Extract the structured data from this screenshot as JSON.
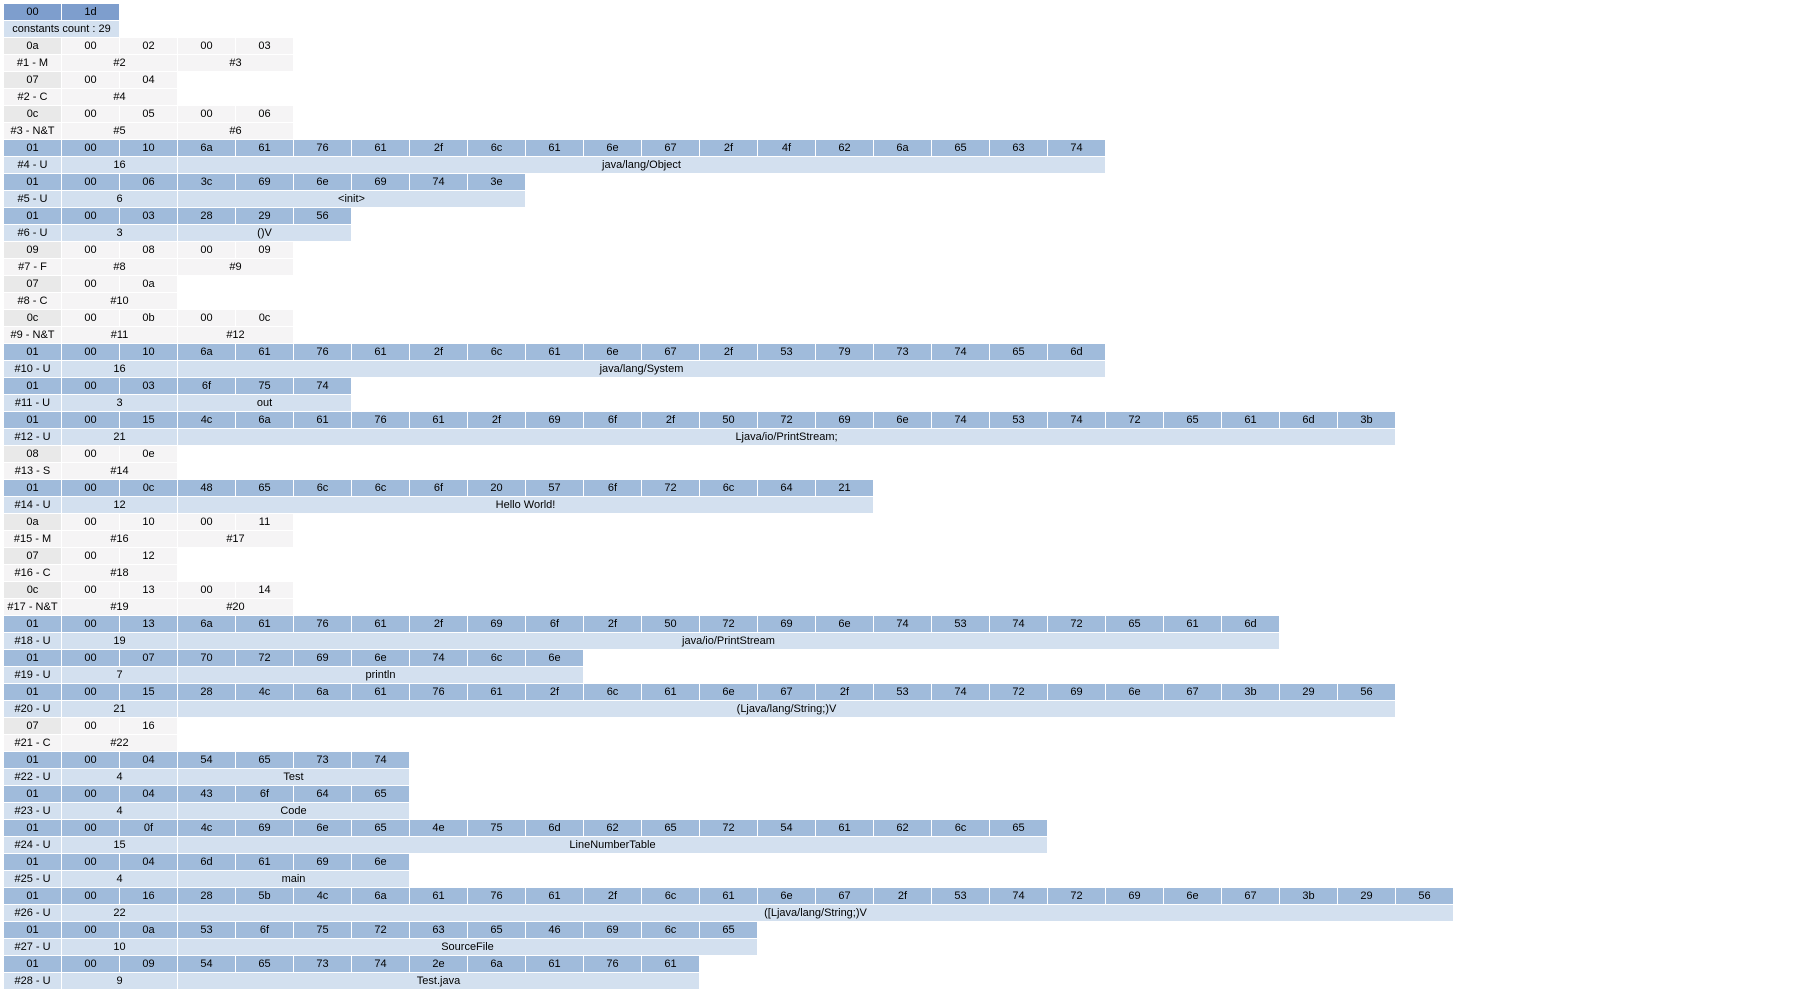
{
  "header_count_hex": [
    "00",
    "1d"
  ],
  "header_count_label": "constants count : 29",
  "constants": [
    {
      "id": 1,
      "type": "M",
      "hex": [
        "0a",
        "00",
        "02",
        "00",
        "03"
      ],
      "refs": [
        "#2",
        "#3"
      ]
    },
    {
      "id": 2,
      "type": "C",
      "hex": [
        "07",
        "00",
        "04"
      ],
      "refs": [
        "#4"
      ]
    },
    {
      "id": 3,
      "type": "N&T",
      "hex": [
        "0c",
        "00",
        "05",
        "00",
        "06"
      ],
      "refs": [
        "#5",
        "#6"
      ]
    },
    {
      "id": 4,
      "type": "U",
      "hex": [
        "01",
        "00",
        "10",
        "6a",
        "61",
        "76",
        "61",
        "2f",
        "6c",
        "61",
        "6e",
        "67",
        "2f",
        "4f",
        "62",
        "6a",
        "65",
        "63",
        "74"
      ],
      "len": 16,
      "text": "java/lang/Object"
    },
    {
      "id": 5,
      "type": "U",
      "hex": [
        "01",
        "00",
        "06",
        "3c",
        "69",
        "6e",
        "69",
        "74",
        "3e"
      ],
      "len": 6,
      "text": "<init>"
    },
    {
      "id": 6,
      "type": "U",
      "hex": [
        "01",
        "00",
        "03",
        "28",
        "29",
        "56"
      ],
      "len": 3,
      "text": "()V"
    },
    {
      "id": 7,
      "type": "F",
      "hex": [
        "09",
        "00",
        "08",
        "00",
        "09"
      ],
      "refs": [
        "#8",
        "#9"
      ]
    },
    {
      "id": 8,
      "type": "C",
      "hex": [
        "07",
        "00",
        "0a"
      ],
      "refs": [
        "#10"
      ]
    },
    {
      "id": 9,
      "type": "N&T",
      "hex": [
        "0c",
        "00",
        "0b",
        "00",
        "0c"
      ],
      "refs": [
        "#11",
        "#12"
      ]
    },
    {
      "id": 10,
      "type": "U",
      "hex": [
        "01",
        "00",
        "10",
        "6a",
        "61",
        "76",
        "61",
        "2f",
        "6c",
        "61",
        "6e",
        "67",
        "2f",
        "53",
        "79",
        "73",
        "74",
        "65",
        "6d"
      ],
      "len": 16,
      "text": "java/lang/System"
    },
    {
      "id": 11,
      "type": "U",
      "hex": [
        "01",
        "00",
        "03",
        "6f",
        "75",
        "74"
      ],
      "len": 3,
      "text": "out"
    },
    {
      "id": 12,
      "type": "U",
      "hex": [
        "01",
        "00",
        "15",
        "4c",
        "6a",
        "61",
        "76",
        "61",
        "2f",
        "69",
        "6f",
        "2f",
        "50",
        "72",
        "69",
        "6e",
        "74",
        "53",
        "74",
        "72",
        "65",
        "61",
        "6d",
        "3b"
      ],
      "len": 21,
      "text": "Ljava/io/PrintStream;"
    },
    {
      "id": 13,
      "type": "S",
      "hex": [
        "08",
        "00",
        "0e"
      ],
      "refs": [
        "#14"
      ]
    },
    {
      "id": 14,
      "type": "U",
      "hex": [
        "01",
        "00",
        "0c",
        "48",
        "65",
        "6c",
        "6c",
        "6f",
        "20",
        "57",
        "6f",
        "72",
        "6c",
        "64",
        "21"
      ],
      "len": 12,
      "text": "Hello World!"
    },
    {
      "id": 15,
      "type": "M",
      "hex": [
        "0a",
        "00",
        "10",
        "00",
        "11"
      ],
      "refs": [
        "#16",
        "#17"
      ]
    },
    {
      "id": 16,
      "type": "C",
      "hex": [
        "07",
        "00",
        "12"
      ],
      "refs": [
        "#18"
      ]
    },
    {
      "id": 17,
      "type": "N&T",
      "hex": [
        "0c",
        "00",
        "13",
        "00",
        "14"
      ],
      "refs": [
        "#19",
        "#20"
      ]
    },
    {
      "id": 18,
      "type": "U",
      "hex": [
        "01",
        "00",
        "13",
        "6a",
        "61",
        "76",
        "61",
        "2f",
        "69",
        "6f",
        "2f",
        "50",
        "72",
        "69",
        "6e",
        "74",
        "53",
        "74",
        "72",
        "65",
        "61",
        "6d"
      ],
      "len": 19,
      "text": "java/io/PrintStream"
    },
    {
      "id": 19,
      "type": "U",
      "hex": [
        "01",
        "00",
        "07",
        "70",
        "72",
        "69",
        "6e",
        "74",
        "6c",
        "6e"
      ],
      "len": 7,
      "text": "println"
    },
    {
      "id": 20,
      "type": "U",
      "hex": [
        "01",
        "00",
        "15",
        "28",
        "4c",
        "6a",
        "61",
        "76",
        "61",
        "2f",
        "6c",
        "61",
        "6e",
        "67",
        "2f",
        "53",
        "74",
        "72",
        "69",
        "6e",
        "67",
        "3b",
        "29",
        "56"
      ],
      "len": 21,
      "text": "(Ljava/lang/String;)V"
    },
    {
      "id": 21,
      "type": "C",
      "hex": [
        "07",
        "00",
        "16"
      ],
      "refs": [
        "#22"
      ]
    },
    {
      "id": 22,
      "type": "U",
      "hex": [
        "01",
        "00",
        "04",
        "54",
        "65",
        "73",
        "74"
      ],
      "len": 4,
      "text": "Test"
    },
    {
      "id": 23,
      "type": "U",
      "hex": [
        "01",
        "00",
        "04",
        "43",
        "6f",
        "64",
        "65"
      ],
      "len": 4,
      "text": "Code"
    },
    {
      "id": 24,
      "type": "U",
      "hex": [
        "01",
        "00",
        "0f",
        "4c",
        "69",
        "6e",
        "65",
        "4e",
        "75",
        "6d",
        "62",
        "65",
        "72",
        "54",
        "61",
        "62",
        "6c",
        "65"
      ],
      "len": 15,
      "text": "LineNumberTable"
    },
    {
      "id": 25,
      "type": "U",
      "hex": [
        "01",
        "00",
        "04",
        "6d",
        "61",
        "69",
        "6e"
      ],
      "len": 4,
      "text": "main"
    },
    {
      "id": 26,
      "type": "U",
      "hex": [
        "01",
        "00",
        "16",
        "28",
        "5b",
        "4c",
        "6a",
        "61",
        "76",
        "61",
        "2f",
        "6c",
        "61",
        "6e",
        "67",
        "2f",
        "53",
        "74",
        "72",
        "69",
        "6e",
        "67",
        "3b",
        "29",
        "56"
      ],
      "len": 22,
      "text": "([Ljava/lang/String;)V"
    },
    {
      "id": 27,
      "type": "U",
      "hex": [
        "01",
        "00",
        "0a",
        "53",
        "6f",
        "75",
        "72",
        "63",
        "65",
        "46",
        "69",
        "6c",
        "65"
      ],
      "len": 10,
      "text": "SourceFile"
    },
    {
      "id": 28,
      "type": "U",
      "hex": [
        "01",
        "00",
        "09",
        "54",
        "65",
        "73",
        "74",
        "2e",
        "6a",
        "61",
        "76",
        "61"
      ],
      "len": 9,
      "text": "Test.java"
    }
  ]
}
